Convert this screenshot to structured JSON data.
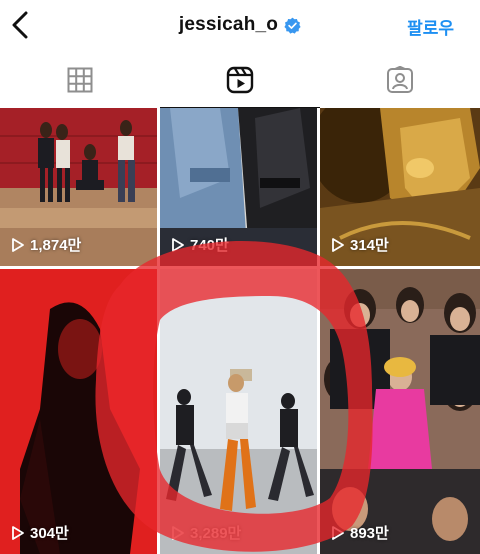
{
  "header": {
    "back_icon": "chevron-left-icon",
    "title": "jessicah_o",
    "verified_icon": "verified-badge-icon",
    "follow_label": "팔로우",
    "accent": "#1d8ff2"
  },
  "tabs": [
    {
      "icon": "grid-icon",
      "selected": false
    },
    {
      "icon": "reels-icon",
      "selected": true
    },
    {
      "icon": "tagged-icon",
      "selected": false
    }
  ],
  "reels": [
    {
      "views": "1,874만"
    },
    {
      "views": "740만"
    },
    {
      "views": "314만"
    },
    {
      "views": "304만"
    },
    {
      "views": "3,289만"
    },
    {
      "views": "893만"
    }
  ],
  "annotation": {
    "color": "#e8262b"
  }
}
